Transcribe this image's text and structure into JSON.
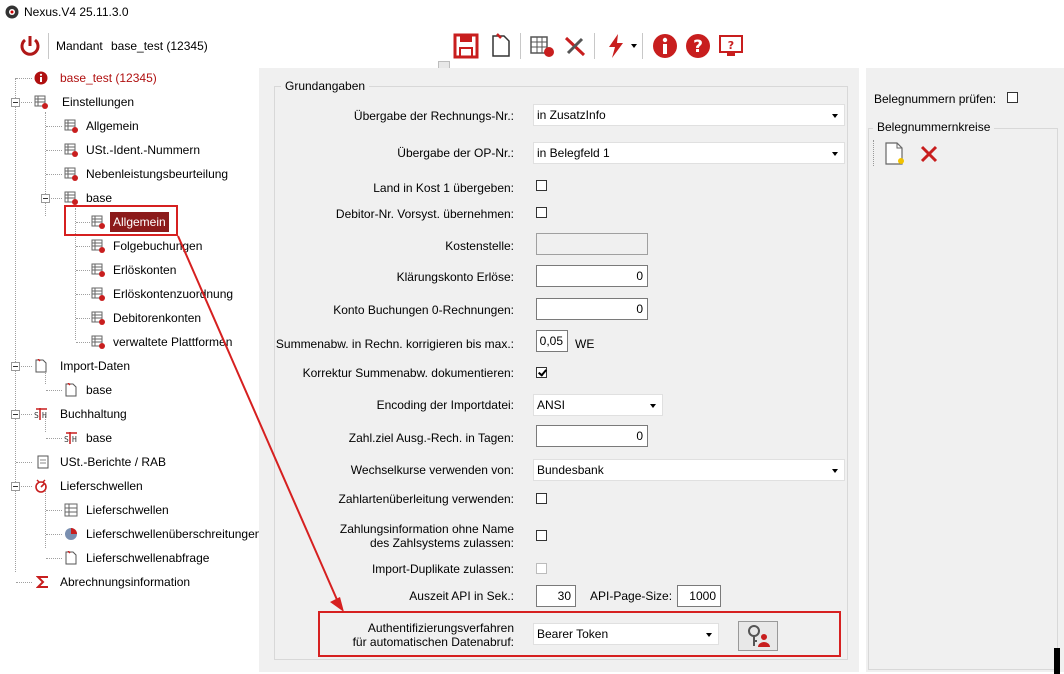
{
  "window": {
    "title": "Nexus.V4 25.11.3.0"
  },
  "toolbar": {
    "mandant_label": "Mandant",
    "mandant_value": "base_test (12345)",
    "icons": [
      "power-icon",
      "save-icon",
      "new-document-icon",
      "table-settings-icon",
      "tools-icon",
      "lightning-icon",
      "info-icon",
      "help-icon",
      "screen-help-icon"
    ]
  },
  "tree": {
    "root": "base_test (12345)",
    "einstellungen": "Einstellungen",
    "allgemein": "Allgemein",
    "ustid": "USt.-Ident.-Nummern",
    "nebenleistung": "Nebenleistungsbeurteilung",
    "base": "base",
    "base_allgemein": "Allgemein",
    "folgebuchungen": "Folgebuchungen",
    "erloeskonten": "Erlöskonten",
    "erloeskontenzuordnung": "Erlöskontenzuordnung",
    "debitorenkonten": "Debitorenkonten",
    "plattformen": "verwaltete Plattformen",
    "import": "Import-Daten",
    "import_base": "base",
    "buchhaltung": "Buchhaltung",
    "buchhaltung_base": "base",
    "ustberichte": "USt.-Berichte / RAB",
    "lieferschwellen": "Lieferschwellen",
    "lieferschwellen_item": "Lieferschwellen",
    "lieferschwellenueber": "Lieferschwellenüberschreitungen",
    "lieferschwellenabfrage": "Lieferschwellenabfrage",
    "abrechnung": "Abrechnungsinformation"
  },
  "form": {
    "group_title": "Grundangaben",
    "uebergabe_rechnung_label": "Übergabe der Rechnungs-Nr.:",
    "uebergabe_rechnung_value": "in ZusatzInfo",
    "uebergabe_op_label": "Übergabe der OP-Nr.:",
    "uebergabe_op_value": "in Belegfeld 1",
    "land_kost_label": "Land in Kost 1 übergeben:",
    "debitor_label": "Debitor-Nr. Vorsyst. übernehmen:",
    "kostenstelle_label": "Kostenstelle:",
    "klaerung_label": "Klärungskonto Erlöse:",
    "klaerung_value": "0",
    "konto0_label": "Konto Buchungen 0-Rechnungen:",
    "konto0_value": "0",
    "summenabw_label": "Summenabw. in Rechn. korrigieren bis max.:",
    "summenabw_value": "0,05",
    "summenabw_unit": "WE",
    "korrektur_label": "Korrektur Summenabw. dokumentieren:",
    "encoding_label": "Encoding der Importdatei:",
    "encoding_value": "ANSI",
    "zahlziel_label": "Zahl.ziel Ausg.-Rech. in Tagen:",
    "zahlziel_value": "0",
    "wechselkurse_label": "Wechselkurse verwenden von:",
    "wechselkurse_value": "Bundesbank",
    "zahlarten_label": "Zahlartenüberleitung verwenden:",
    "zahlungsinfo_label_1": "Zahlungsinformation ohne Name",
    "zahlungsinfo_label_2": "des Zahlsystems zulassen:",
    "duplikate_label": "Import-Duplikate zulassen:",
    "auszeit_label": "Auszeit API in Sek.:",
    "auszeit_value": "30",
    "pagesize_label": "API-Page-Size:",
    "pagesize_value": "1000",
    "auth_label_1": "Authentifizierungsverfahren",
    "auth_label_2": "für automatischen Datenabruf:",
    "auth_value": "Bearer Token"
  },
  "right": {
    "belegnummern_label": "Belegnummern prüfen:",
    "kreise_title": "Belegnummernkreise"
  },
  "colors": {
    "accent": "#8b1a1a",
    "highlight": "#d62020",
    "icon_red": "#c81e1e"
  }
}
